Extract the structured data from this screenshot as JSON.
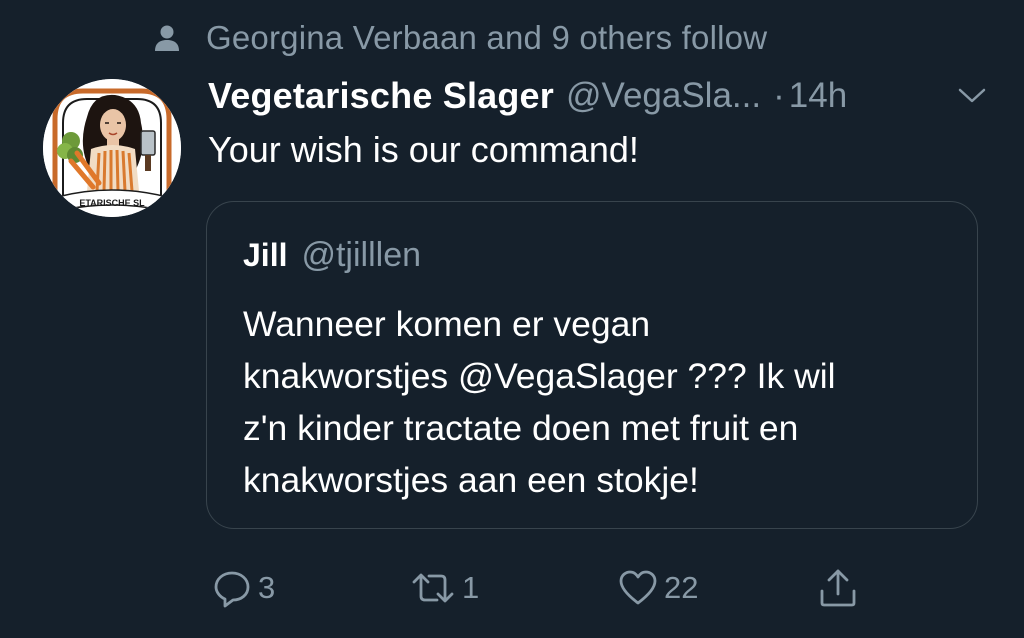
{
  "social_context": {
    "text": "Georgina Verbaan and 9 others follow",
    "icon": "person-icon"
  },
  "tweet": {
    "author_name": "Vegetarische Slager",
    "handle": "@VegaSla...",
    "separator": "·",
    "time": "14h",
    "text": "Your wish is our command!",
    "avatar_label": "ETARISCHE SL",
    "caret_icon": "chevron-down-icon"
  },
  "quoted_tweet": {
    "author_name": "Jill",
    "handle": "@tjilllen",
    "text": "Wanneer komen er vegan\nknakworstjes @VegaSlager ??? Ik wil\nz'n kinder tractate doen met fruit en\nknakworstjes aan een stokje!"
  },
  "actions": {
    "reply": {
      "icon": "reply-icon",
      "count": "3"
    },
    "retweet": {
      "icon": "retweet-icon",
      "count": "1"
    },
    "like": {
      "icon": "heart-icon",
      "count": "22"
    },
    "share": {
      "icon": "share-icon"
    }
  },
  "colors": {
    "background": "#15202b",
    "primary_text": "#ffffff",
    "secondary_text": "#8899a6",
    "border": "#38444d"
  }
}
